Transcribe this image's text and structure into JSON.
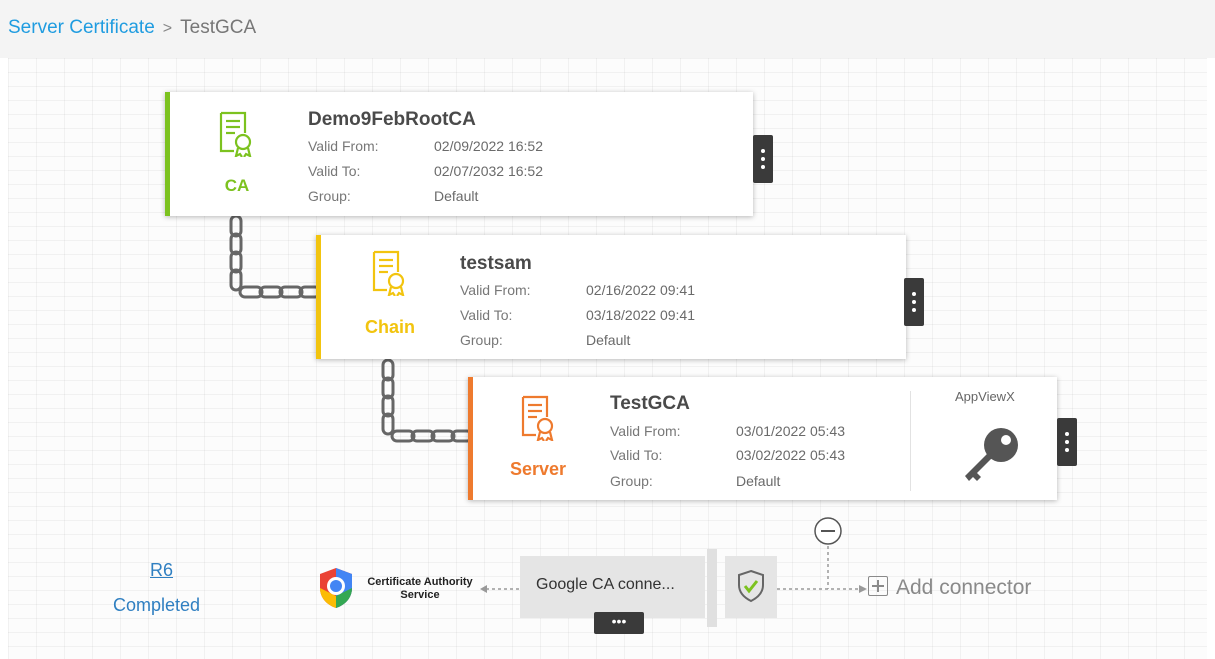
{
  "breadcrumb": {
    "parent": "Server Certificate",
    "separator": ">",
    "current": "TestGCA"
  },
  "certificates": [
    {
      "type_label": "CA",
      "name": "Demo9FebRootCA",
      "valid_from_label": "Valid From:",
      "valid_from": "02/09/2022 16:52",
      "valid_to_label": "Valid To:",
      "valid_to": "02/07/2032 16:52",
      "group_label": "Group:",
      "group": "Default",
      "color": "#7cc21f"
    },
    {
      "type_label": "Chain",
      "name": "testsam",
      "valid_from_label": "Valid From:",
      "valid_from": "02/16/2022 09:41",
      "valid_to_label": "Valid To:",
      "valid_to": "03/18/2022 09:41",
      "group_label": "Group:",
      "group": "Default",
      "color": "#f2c40f"
    },
    {
      "type_label": "Server",
      "name": "TestGCA",
      "valid_from_label": "Valid From:",
      "valid_from": "03/01/2022 05:43",
      "valid_to_label": "Valid To:",
      "valid_to": "03/02/2022 05:43",
      "group_label": "Group:",
      "group": "Default",
      "color": "#ee7a2e",
      "ca_label": "AppViewX"
    }
  ],
  "status": {
    "request_id": "R6",
    "state": "Completed"
  },
  "connector": {
    "ca_service_line1": "Certificate Authority",
    "ca_service_line2": "Service",
    "name": "Google CA conne...",
    "more": "•••",
    "add_label": "Add connector"
  },
  "colors": {
    "link": "#1f9ce0",
    "ca": "#7cc21f",
    "chain": "#f2c40f",
    "server": "#ee7a2e",
    "menu": "#3a3a3a"
  }
}
